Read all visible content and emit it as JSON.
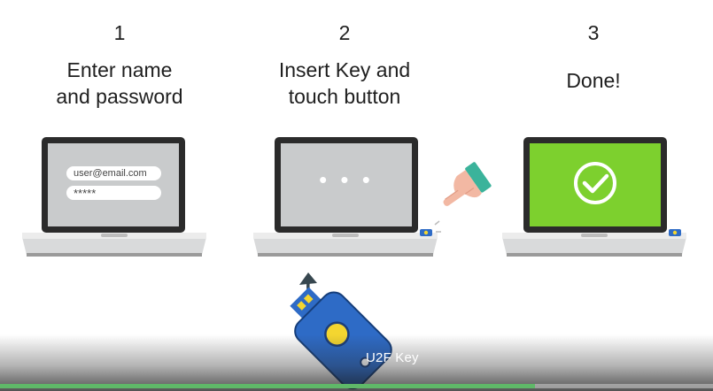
{
  "steps": [
    {
      "number": "1",
      "text": "Enter name\nand password"
    },
    {
      "number": "2",
      "text": "Insert Key and\ntouch button"
    },
    {
      "number": "3",
      "text": "Done!"
    }
  ],
  "login_form": {
    "email": "user@email.com",
    "password": "*****"
  },
  "screen2_dots": "• • •",
  "key_label": "U2F Key",
  "progress": {
    "fraction": 0.75
  },
  "colors": {
    "laptop_frame": "#2b2b2b",
    "screen_gray": "#c9cbcc",
    "screen_green": "#7dd02e",
    "key_blue": "#2e6bc6",
    "key_yellow": "#f4d630",
    "sleeve_teal": "#3bb39b",
    "hand_skin": "#f2b8a3",
    "progress_green": "#5fb868"
  },
  "icons": [
    "checkmark-circle-icon",
    "hand-pointer-icon",
    "usb-key-icon",
    "curved-arrow-icon"
  ]
}
